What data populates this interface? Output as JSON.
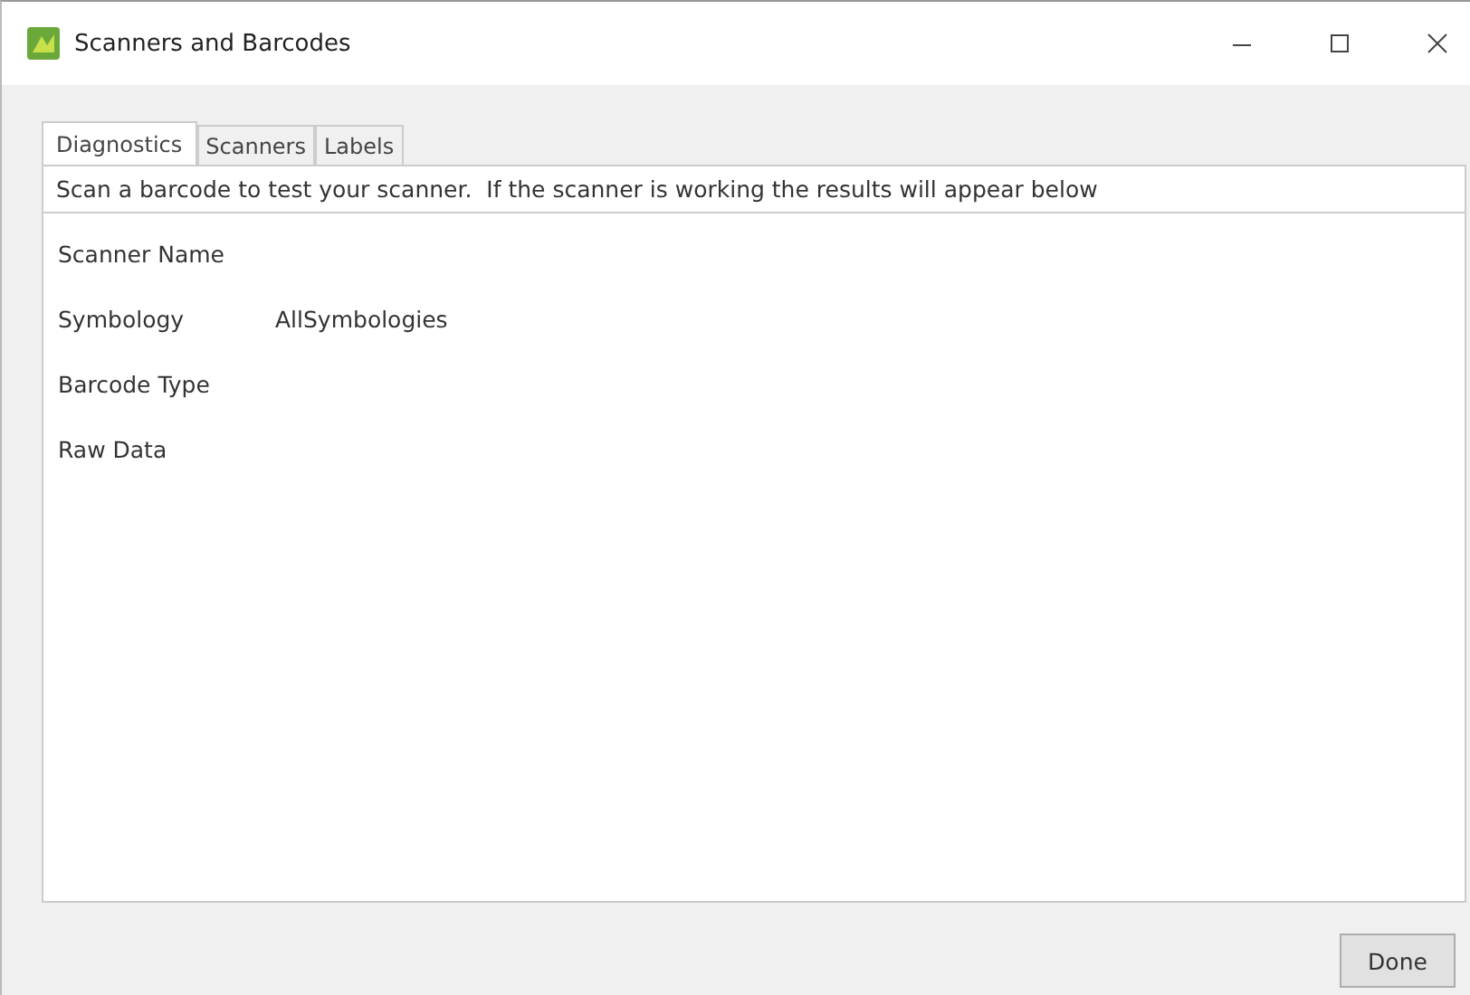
{
  "window": {
    "title": "Scanners and Barcodes"
  },
  "tabs": [
    {
      "label": "Diagnostics",
      "selected": true
    },
    {
      "label": "Scanners",
      "selected": false
    },
    {
      "label": "Labels",
      "selected": false
    }
  ],
  "instructions": "Scan a barcode to test your scanner.  If the scanner is working the results will appear below",
  "fields": [
    {
      "label": "Scanner Name"
    },
    {
      "label": "Symbology",
      "value": "AllSymbologies"
    },
    {
      "label": "Barcode Type"
    },
    {
      "label": "Raw Data"
    }
  ],
  "buttons": [
    "Done"
  ]
}
